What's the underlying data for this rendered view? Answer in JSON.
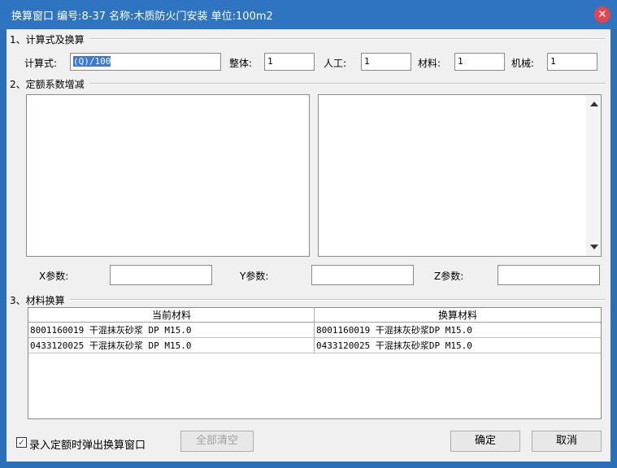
{
  "window": {
    "title": "换算窗口 编号:8-37 名称:木质防火门安装 单位:100m2"
  },
  "section1": {
    "label": "1、计算式及换算",
    "formula_label": "计算式:",
    "formula_value": "(Q)/100",
    "whole_label": "整体:",
    "whole_value": "1",
    "labor_label": "人工:",
    "labor_value": "1",
    "material_label": "材料:",
    "material_value": "1",
    "machine_label": "机械:",
    "machine_value": "1"
  },
  "section2": {
    "label": "2、定额系数增减",
    "x_label": "X参数:",
    "y_label": "Y参数:",
    "z_label": "Z参数:",
    "x_value": "",
    "y_value": "",
    "z_value": ""
  },
  "section3": {
    "label": "3、材料换算",
    "columns": [
      "当前材料",
      "换算材料"
    ],
    "rows": [
      [
        "8001160019 干混抹灰砂浆 DP M15.0",
        "8001160019 干混抹灰砂浆DP M15.0"
      ],
      [
        "0433120025 干混抹灰砂浆 DP M15.0",
        "0433120025 干混抹灰砂浆DP M15.0"
      ]
    ]
  },
  "footer": {
    "checkbox_label": "录入定额时弹出换算窗口",
    "checkbox_checked": true,
    "clear_all_label": "全部清空",
    "ok_label": "确定",
    "cancel_label": "取消"
  },
  "colors": {
    "titlebar": "#2e74c0",
    "close": "#e8434a",
    "selection": "#3b78d8"
  }
}
